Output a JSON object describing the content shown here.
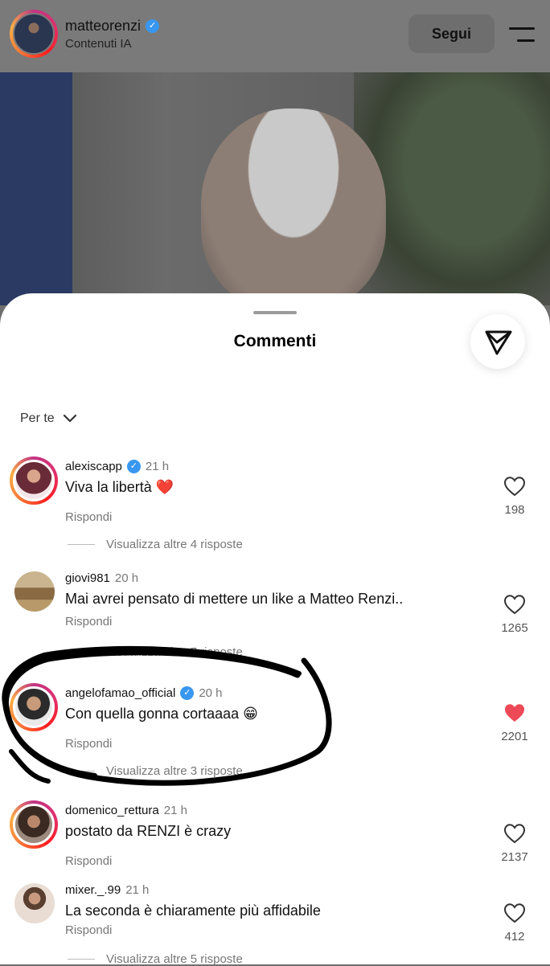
{
  "header": {
    "username": "matteorenzi",
    "subtitle": "Contenuti IA",
    "follow_label": "Segui"
  },
  "sheet": {
    "title": "Commenti",
    "filter_label": "Per te"
  },
  "comments": [
    {
      "username": "alexiscapp",
      "verified": true,
      "time": "21 h",
      "text": "Viva la libertà ❤️",
      "reply_label": "Rispondi",
      "likes": "198",
      "liked": false,
      "more_replies": "Visualizza altre 4 risposte"
    },
    {
      "username": "giovi981",
      "verified": false,
      "time": "20 h",
      "text": "Mai avrei pensato di mettere un like a Matteo Renzi..",
      "reply_label": "Rispondi",
      "likes": "1265",
      "liked": false,
      "more_replies": "Visualizza altre 7 risposte"
    },
    {
      "username": "angelofamao_official",
      "verified": true,
      "time": "20 h",
      "text": "Con quella gonna cortaaaa 😁",
      "reply_label": "Rispondi",
      "likes": "2201",
      "liked": true,
      "more_replies": "Visualizza altre 3 risposte"
    },
    {
      "username": "domenico_rettura",
      "verified": false,
      "time": "21 h",
      "text": "postato da RENZI è crazy",
      "reply_label": "Rispondi",
      "likes": "2137",
      "liked": false,
      "more_replies": ""
    },
    {
      "username": "mixer._.99",
      "verified": false,
      "time": "21 h",
      "text": "La seconda è chiaramente più affidabile",
      "reply_label": "Rispondi",
      "likes": "412",
      "liked": false,
      "more_replies": "Visualizza altre 5 risposte"
    }
  ],
  "colors": {
    "like_red": "#ed4956",
    "verified_blue": "#3897f0",
    "scribble": "#000000"
  },
  "icons": {
    "verified": "verified-badge-icon",
    "menu": "hamburger-menu-icon",
    "send": "send-icon",
    "chevron": "chevron-down-icon",
    "heart": "heart-icon"
  }
}
